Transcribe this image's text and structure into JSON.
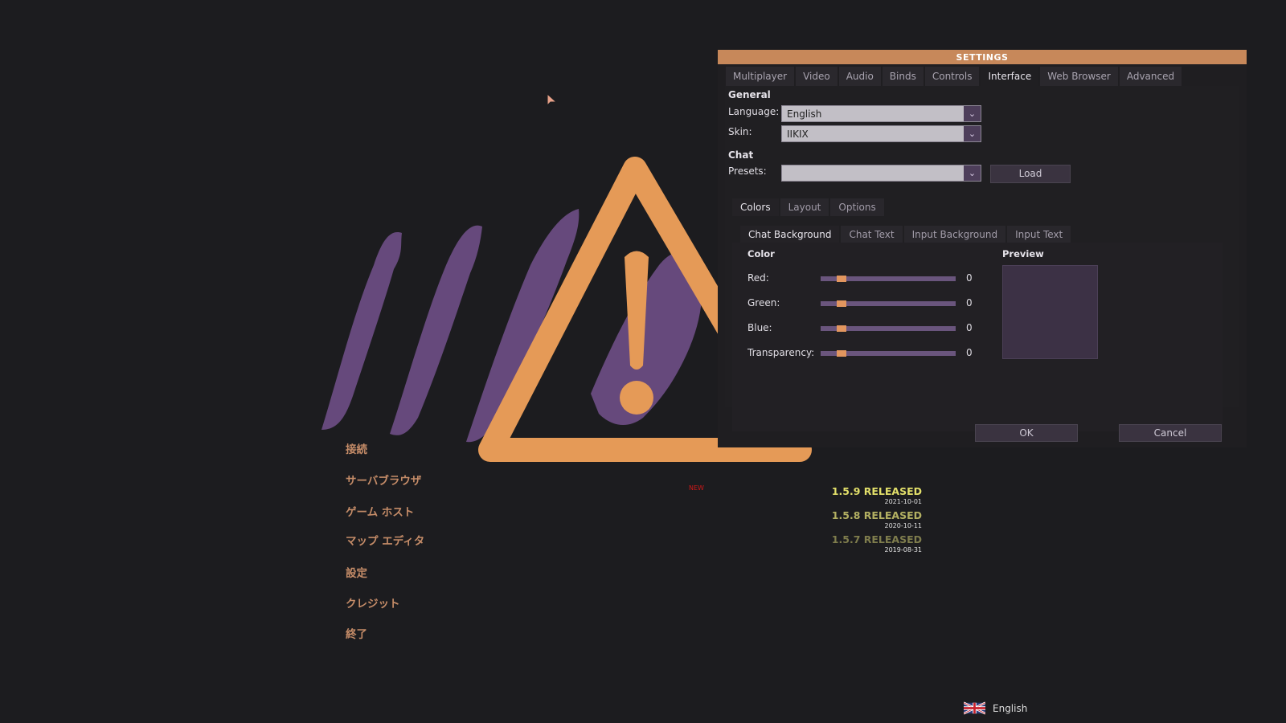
{
  "main_menu": {
    "items": [
      "接続",
      "サーバブラウザ",
      "ゲーム ホスト",
      "マップ エディタ",
      "設定",
      "クレジット",
      "終了"
    ],
    "new_badge": "NEW"
  },
  "news": [
    {
      "title": "1.5.9 RELEASED",
      "date": "2021-10-01",
      "color": "#e2df6a"
    },
    {
      "title": "1.5.8 RELEASED",
      "date": "2020-10-11",
      "color": "#b3b062"
    },
    {
      "title": "1.5.7 RELEASED",
      "date": "2019-08-31",
      "color": "#7f7d4d"
    }
  ],
  "footer": {
    "language": "English",
    "flag_icon": "uk-flag-icon"
  },
  "settings": {
    "title": "SETTINGS",
    "tabs": [
      "Multiplayer",
      "Video",
      "Audio",
      "Binds",
      "Controls",
      "Interface",
      "Web Browser",
      "Advanced"
    ],
    "active_tab": "Interface",
    "general": {
      "heading": "General",
      "language_label": "Language:",
      "language_value": "English",
      "skin_label": "Skin:",
      "skin_value": "IIKIX"
    },
    "chat": {
      "heading": "Chat",
      "presets_label": "Presets:",
      "presets_value": "",
      "load_button": "Load",
      "subtabs": [
        "Colors",
        "Layout",
        "Options"
      ],
      "active_subtab": "Colors",
      "color_tabs": [
        "Chat Background",
        "Chat Text",
        "Input Background",
        "Input Text"
      ],
      "active_color_tab": "Chat Background",
      "color_heading": "Color",
      "preview_heading": "Preview",
      "sliders": [
        {
          "label": "Red:",
          "value": "0"
        },
        {
          "label": "Green:",
          "value": "0"
        },
        {
          "label": "Blue:",
          "value": "0"
        },
        {
          "label": "Transparency:",
          "value": "0"
        }
      ]
    },
    "ok_button": "OK",
    "cancel_button": "Cancel"
  },
  "colors": {
    "accent": "#e59a57",
    "title_bar": "#c7885a",
    "logo_purple": "#66497c",
    "menu_text": "#c58c68"
  }
}
